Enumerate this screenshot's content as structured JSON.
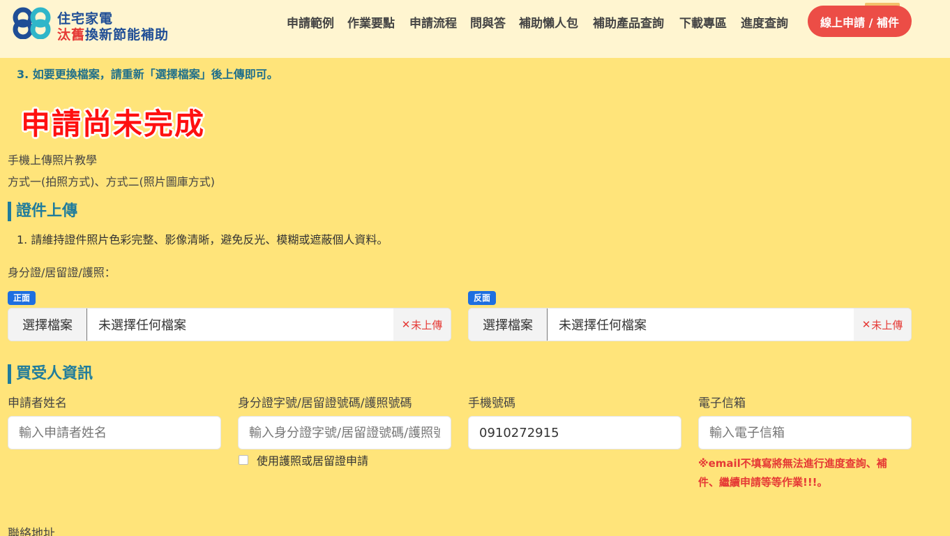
{
  "header": {
    "logo_line1": "住宅家電",
    "logo_line2_red": "汰舊",
    "logo_line2_blue": "換新節能補助",
    "nav": [
      {
        "label": "申請範例"
      },
      {
        "label": "作業要點"
      },
      {
        "label": "申請流程"
      },
      {
        "label": "問與答"
      },
      {
        "label": "補助懶人包"
      },
      {
        "label": "補助產品查詢"
      },
      {
        "label": "下載專區"
      },
      {
        "label": "進度查詢"
      }
    ],
    "cta_label": "線上申請 / 補件",
    "colors": {
      "brand_blue": "#1f4e96",
      "brand_red": "#e53935",
      "cta": "#ec4d46"
    }
  },
  "notes": {
    "note_3": "3. 如要更換檔案，請重新「選擇檔案」後上傳即可。"
  },
  "status_banner": "申請尚未完成",
  "tutorial": {
    "title": "手機上傳照片教學",
    "methods": "方式一(拍照方式)、方式二(照片圖庫方式)"
  },
  "document_upload": {
    "section_title": "證件上傳",
    "note_1": "1. 請維持證件照片色彩完整、影像清晰，避免反光、模糊或遮蔽個人資料。",
    "id_label": "身分證/居留證/護照：",
    "front": {
      "badge": "正面",
      "button": "選擇檔案",
      "filename": "未選擇任何檔案",
      "status_mark": "✕",
      "status": "未上傳"
    },
    "back": {
      "badge": "反面",
      "button": "選擇檔案",
      "filename": "未選擇任何檔案",
      "status_mark": "✕",
      "status": "未上傳"
    }
  },
  "buyer": {
    "section_title": "買受人資訊",
    "name_label": "申請者姓名",
    "name_placeholder": "輸入申請者姓名",
    "id_label": "身分證字號/居留證號碼/護照號碼",
    "id_placeholder": "輸入身分證字號/居留證號碼/護照號碼",
    "passport_checkbox": "使用護照或居留證申請",
    "phone_label": "手機號碼",
    "phone_value": "0910272915",
    "email_label": "電子信箱",
    "email_placeholder": "輸入電子信箱",
    "email_warning": "※email不填寫將無法進行進度查詢、補件、繼續申請等等作業!!!。",
    "address_label": "聯絡地址"
  }
}
